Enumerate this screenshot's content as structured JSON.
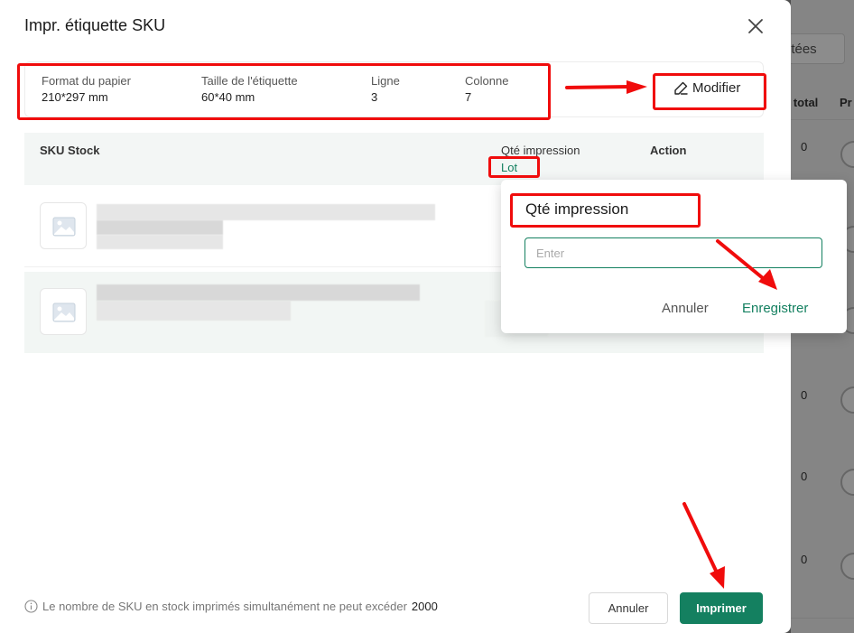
{
  "modal": {
    "title": "Impr. étiquette SKU"
  },
  "config": {
    "paper_label": "Format du papier",
    "paper_value": "210*297 mm",
    "label_size_label": "Taille de l'étiquette",
    "label_size_value": "60*40 mm",
    "row_label": "Ligne",
    "row_value": "3",
    "col_label": "Colonne",
    "col_value": "7",
    "modify_label": "Modifier"
  },
  "table": {
    "col_sku": "SKU Stock",
    "col_qty": "Qté impression",
    "col_action": "Action",
    "lot_link": "Lot"
  },
  "popover": {
    "title": "Qté impression",
    "input_placeholder": "Enter",
    "cancel_label": "Annuler",
    "save_label": "Enregistrer"
  },
  "footer": {
    "note": "Le nombre de SKU en stock imprimés simultanément ne peut excéder",
    "limit": "2000",
    "cancel_label": "Annuler",
    "print_label": "Imprimer"
  },
  "background": {
    "button_label": "itées",
    "col_total": "k total",
    "col_pr": "Pr",
    "row_values": [
      "0",
      "0",
      "0",
      "0",
      "0"
    ]
  },
  "colors": {
    "accent": "#148060",
    "annotation": "#f00c0c"
  }
}
